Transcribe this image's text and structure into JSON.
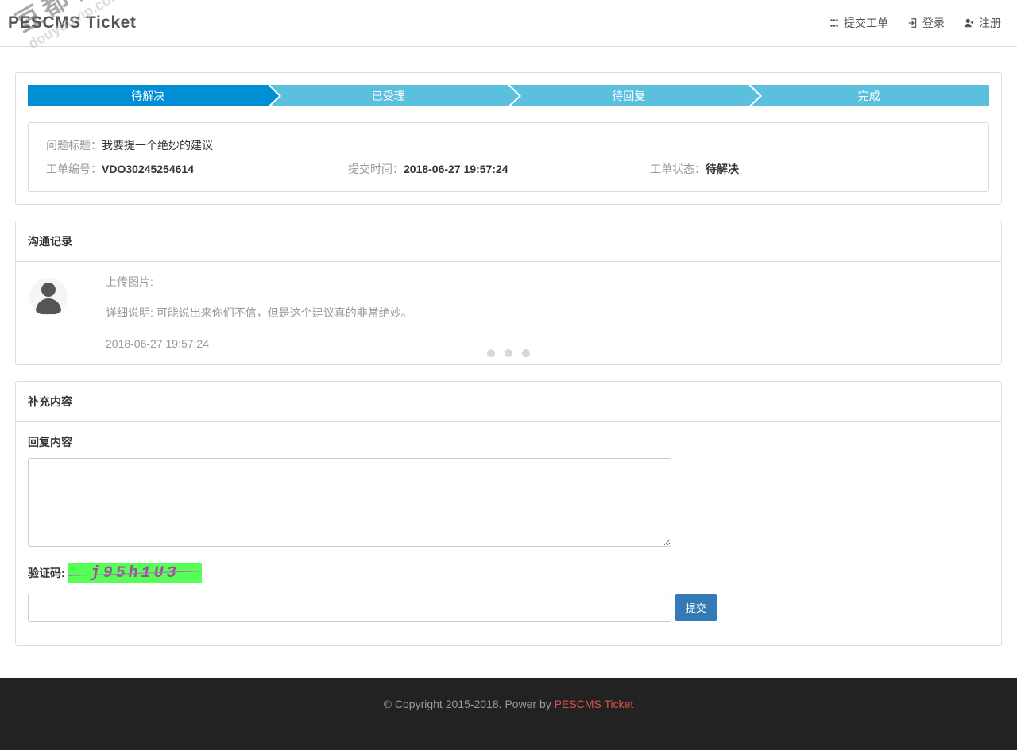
{
  "watermark": {
    "line1": "豆都有综合资源",
    "line2": "douyouvip.com"
  },
  "header": {
    "logo": "PESCMS Ticket",
    "nav": {
      "submit": "提交工单",
      "login": "登录",
      "register": "注册"
    }
  },
  "steps": {
    "pending": "待解决",
    "accepted": "已受理",
    "awaiting": "待回复",
    "done": "完成"
  },
  "ticket": {
    "title_label": "问题标题：",
    "title_value": "我要提一个绝妙的建议",
    "number_label": "工单编号：",
    "number_value": "VDO30245254614",
    "submit_time_label": "提交时间：",
    "submit_time_value": "2018-06-27 19:57:24",
    "status_label": "工单状态：",
    "status_value": "待解决"
  },
  "communication": {
    "heading": "沟通记录",
    "upload_label": "上传图片:",
    "detail_label": "详细说明:",
    "detail_text": "可能说出来你们不信，但是这个建议真的非常绝妙。",
    "timestamp": "2018-06-27 19:57:24"
  },
  "supplement": {
    "heading": "补充内容",
    "reply_label": "回复内容",
    "captcha_label": "验证码:",
    "captcha_text": "j95h1U3",
    "submit_btn": "提交"
  },
  "footer": {
    "copyright": "© Copyright 2015-2018. Power by ",
    "link_text": "PESCMS Ticket"
  }
}
